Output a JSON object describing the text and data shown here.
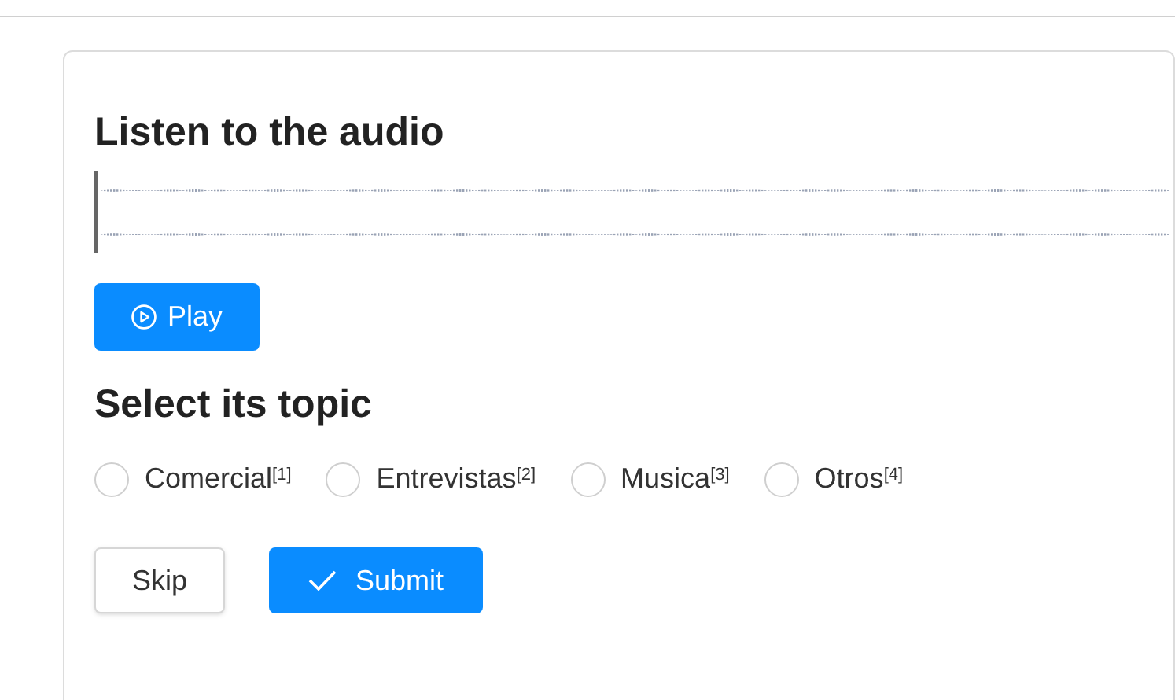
{
  "title": "Listen to the audio",
  "play_button": "Play",
  "topic_heading": "Select its topic",
  "options": [
    {
      "label": "Comercial$^{[1]}$",
      "selected": false
    },
    {
      "label": "Entrevistas$^{[2]}$",
      "selected": false
    },
    {
      "label": "Musica$^{[3]}$",
      "selected": false
    },
    {
      "label": "Otros$^{[4]}$",
      "selected": false
    }
  ],
  "skip_button": "Skip",
  "submit_button": "Submit"
}
